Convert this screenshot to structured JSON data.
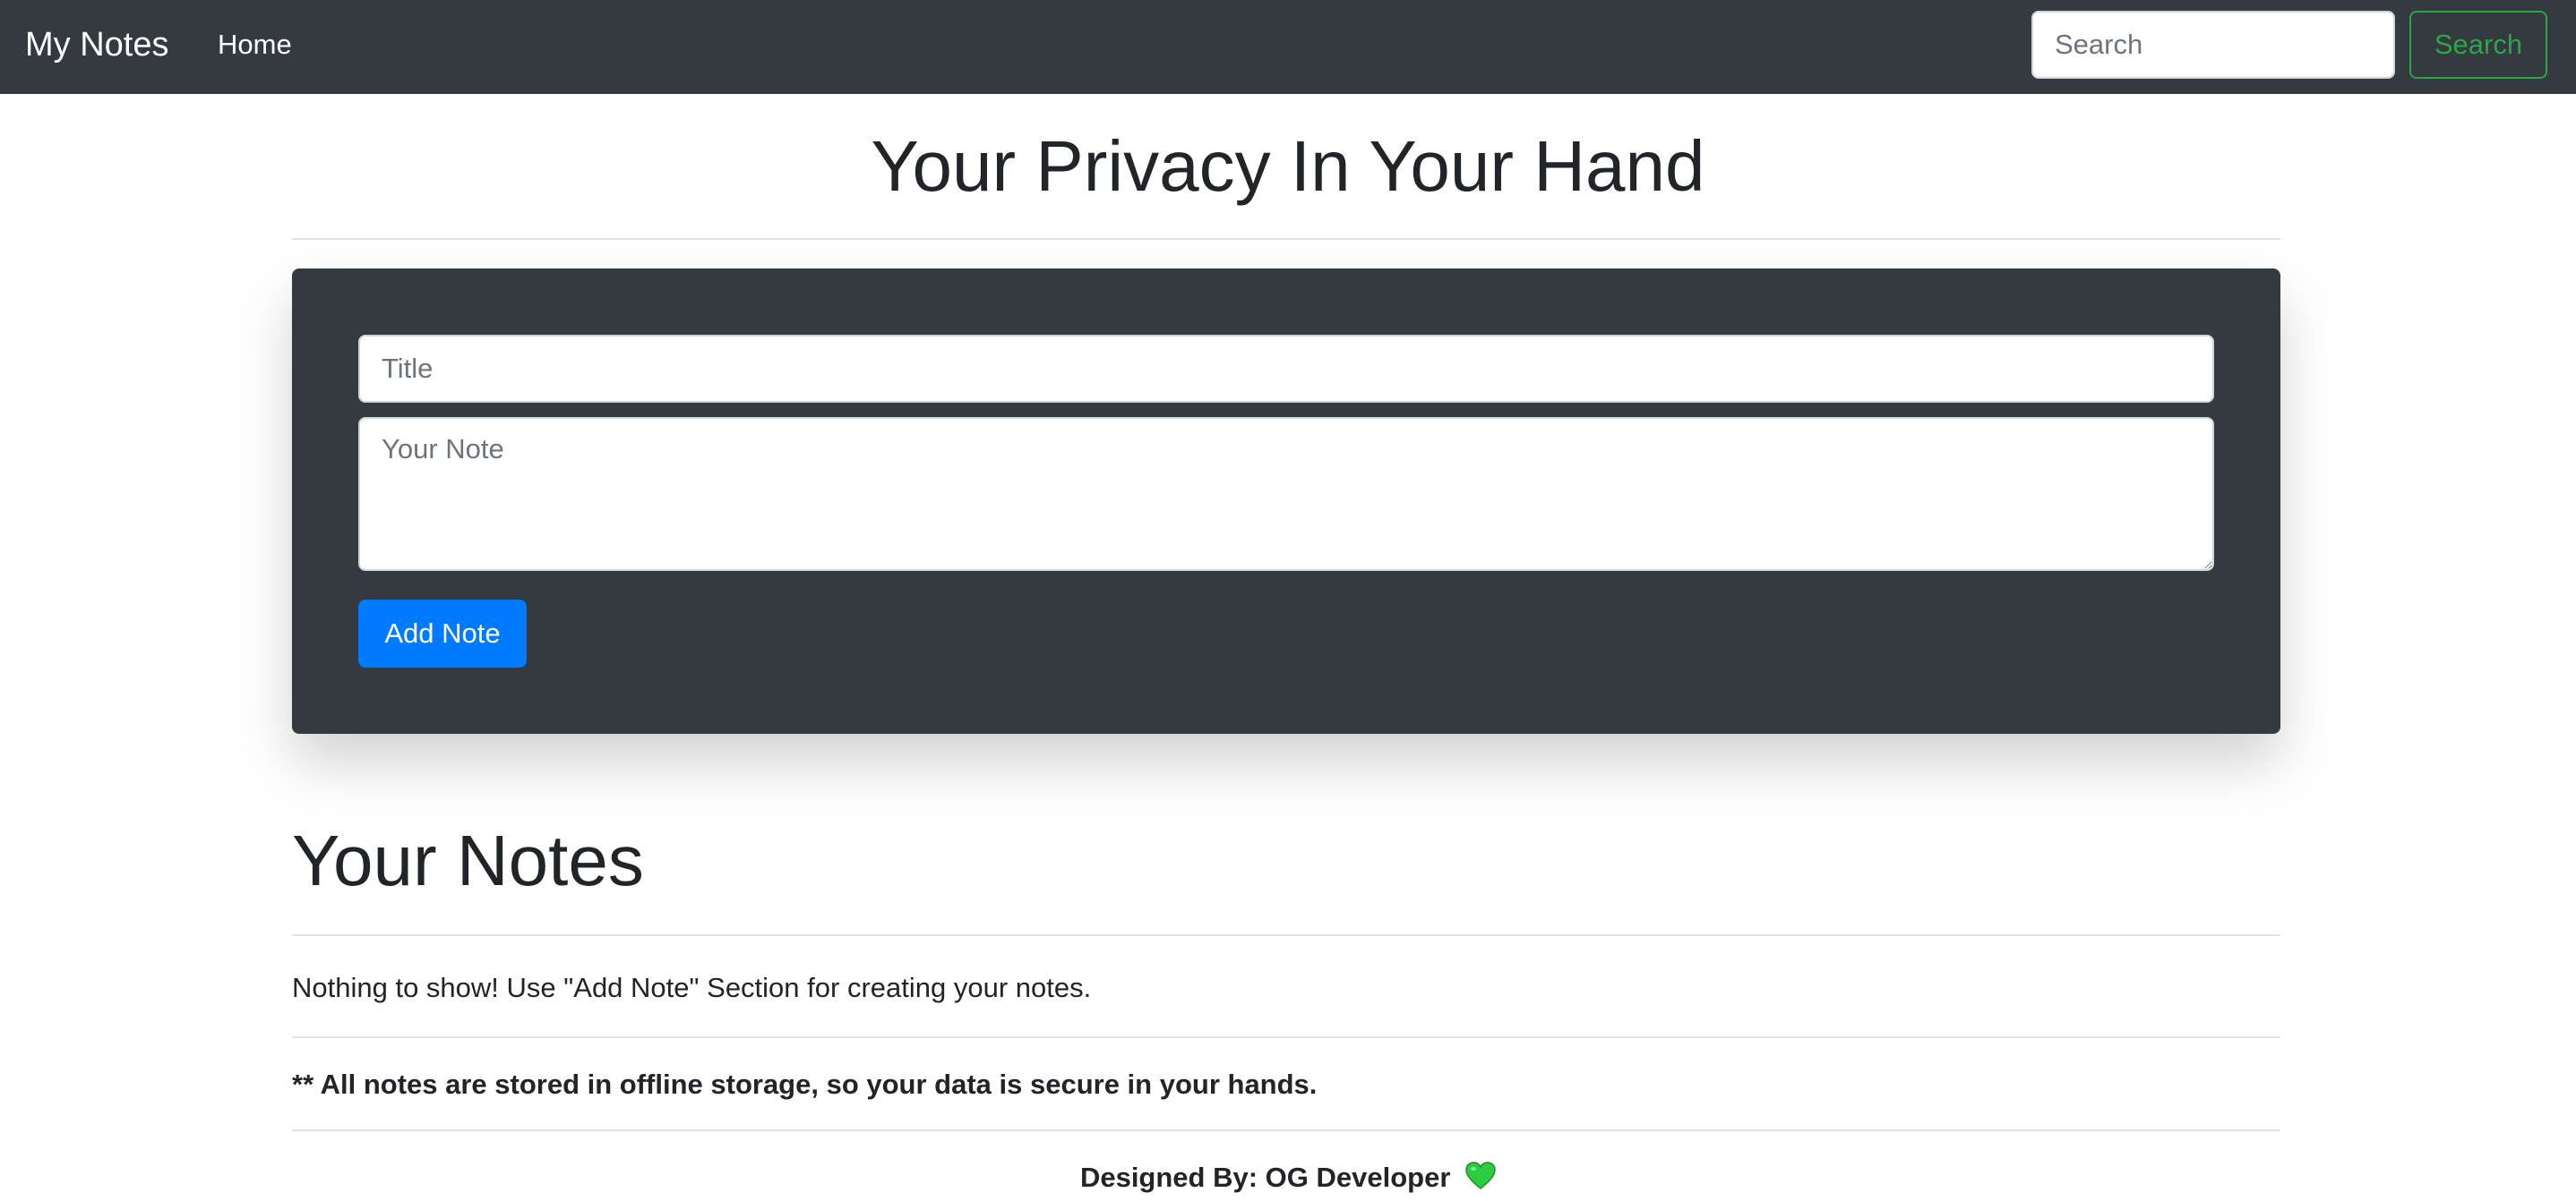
{
  "navbar": {
    "brand": "My Notes",
    "home_link": "Home",
    "search_placeholder": "Search",
    "search_button": "Search"
  },
  "header": {
    "title": "Your Privacy In Your Hand"
  },
  "form": {
    "title_placeholder": "Title",
    "note_placeholder": "Your Note",
    "add_button": "Add Note"
  },
  "notes": {
    "heading": "Your Notes",
    "empty_message": "Nothing to show! Use \"Add Note\" Section for creating your notes.",
    "storage_info": "** All notes are stored in offline storage, so your data is secure in your hands."
  },
  "footer": {
    "credit": "Designed By: OG Developer",
    "heart_icon": "green-heart-icon"
  },
  "colors": {
    "navbar_bg": "#343a40",
    "primary": "#007bff",
    "success": "#28a745"
  }
}
